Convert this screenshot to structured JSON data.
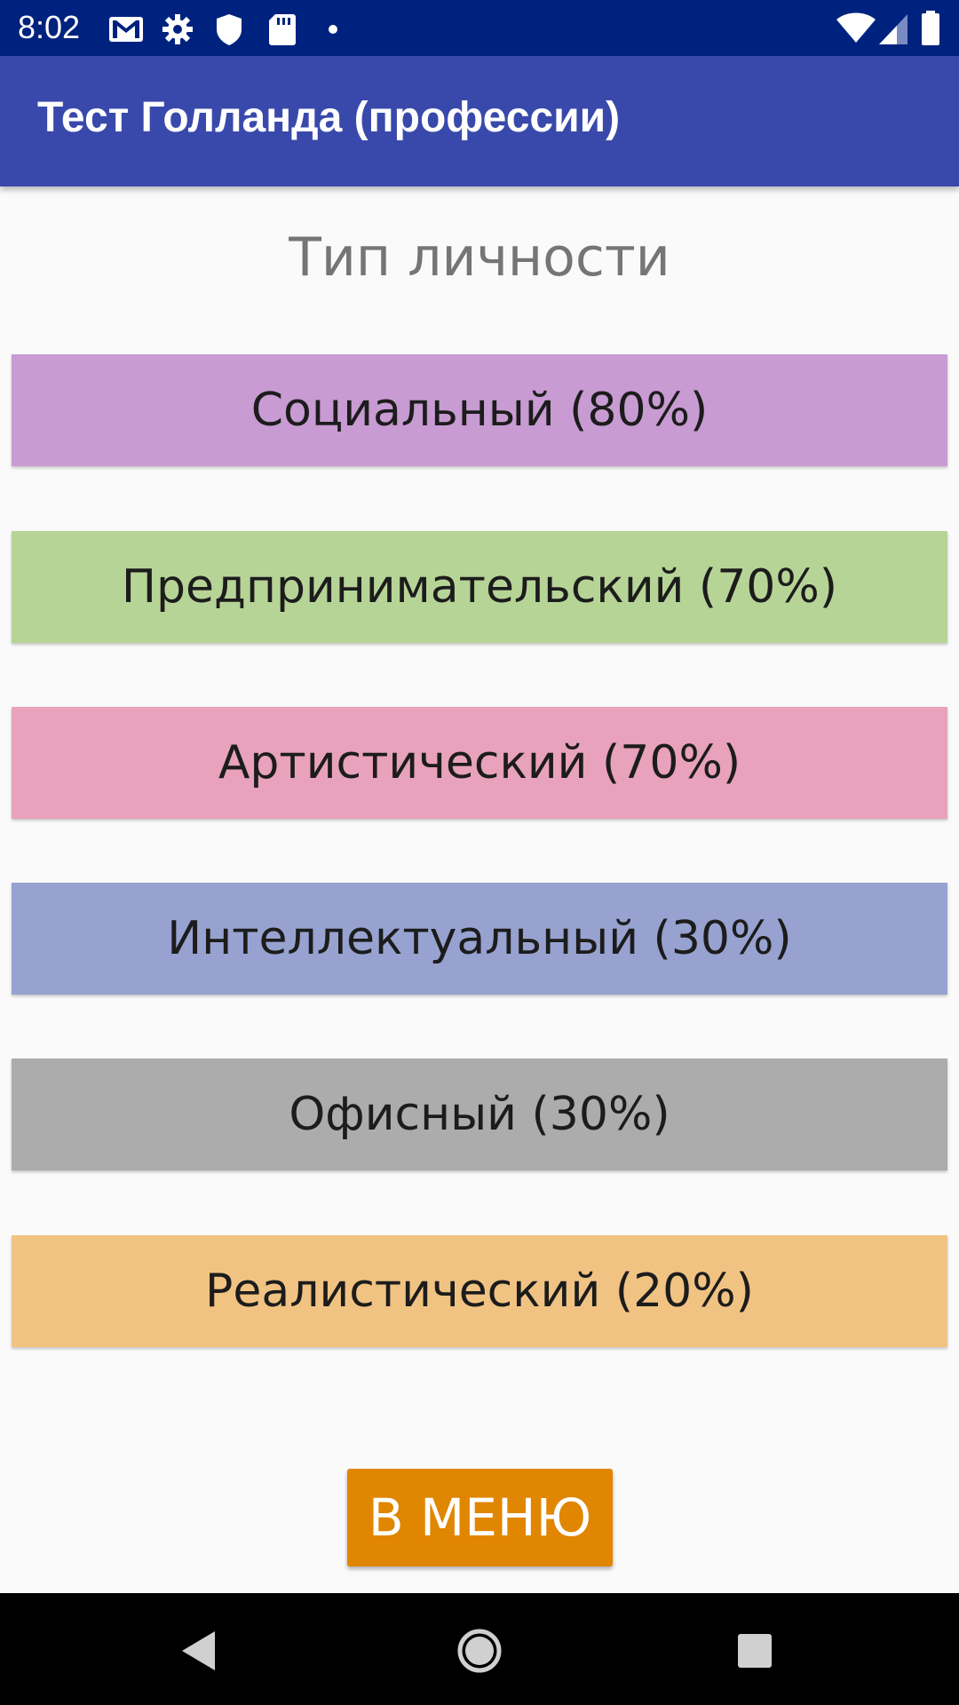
{
  "status_bar": {
    "time": "8:02",
    "left_icons": [
      "gmail-icon",
      "settings-gear-icon",
      "shield-icon",
      "sd-card-icon",
      "notification-dot-icon"
    ],
    "right_icons": [
      "wifi-icon",
      "cellular-signal-icon",
      "battery-icon"
    ]
  },
  "app_bar": {
    "title": "Тест Голланда (профессии)"
  },
  "main": {
    "section_title": "Тип личности",
    "results": [
      {
        "label": "Социальный (80%)",
        "percent": 80,
        "color": "#c89bd2"
      },
      {
        "label": "Предпринимательский (70%)",
        "percent": 70,
        "color": "#b7d497"
      },
      {
        "label": "Артистический (70%)",
        "percent": 70,
        "color": "#e8a2bb"
      },
      {
        "label": "Интеллектуальный (30%)",
        "percent": 30,
        "color": "#97a2d0"
      },
      {
        "label": "Офисный (30%)",
        "percent": 30,
        "color": "#acacac"
      },
      {
        "label": "Реалистический (20%)",
        "percent": 20,
        "color": "#f1c383"
      }
    ],
    "menu_button_label": "В МЕНЮ"
  },
  "nav_bar": {
    "buttons": [
      "back-icon",
      "home-icon",
      "recents-icon"
    ]
  },
  "colors": {
    "status_bar": "#00227f",
    "app_bar": "#3949ab",
    "accent_button": "#e08600",
    "background": "#fafafa"
  }
}
